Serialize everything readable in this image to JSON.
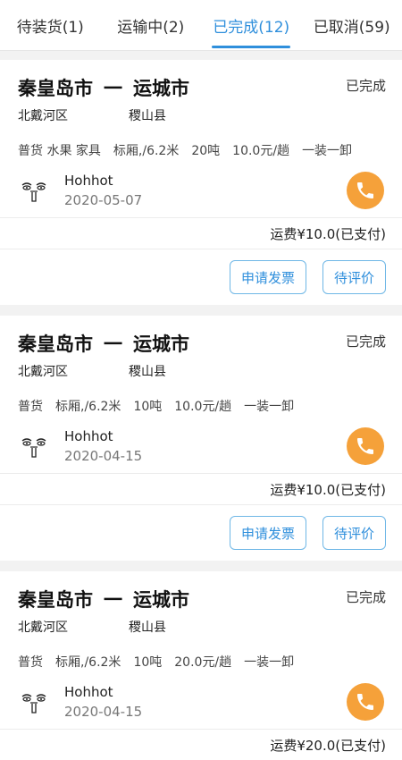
{
  "tabs": [
    {
      "label": "待装货(1)",
      "active": false
    },
    {
      "label": "运输中(2)",
      "active": false
    },
    {
      "label": "已完成(12)",
      "active": true
    },
    {
      "label": "已取消(59)",
      "active": false
    }
  ],
  "orders": [
    {
      "from_city": "秦皇岛市",
      "dash": "一",
      "to_city": "运城市",
      "from_district": "北戴河区",
      "to_district": "稷山县",
      "status": "已完成",
      "goods": [
        "普货 水果 家具",
        "标厢,/6.2米",
        "20吨",
        "10.0元/趟",
        "一装一卸"
      ],
      "contact_name": "Hohhot",
      "date": "2020-05-07",
      "fee": "运费¥10.0(已支付)",
      "buttons": [
        "申请发票",
        "待评价"
      ]
    },
    {
      "from_city": "秦皇岛市",
      "dash": "一",
      "to_city": "运城市",
      "from_district": "北戴河区",
      "to_district": "稷山县",
      "status": "已完成",
      "goods": [
        "普货",
        "标厢,/6.2米",
        "10吨",
        "10.0元/趟",
        "一装一卸"
      ],
      "contact_name": "Hohhot",
      "date": "2020-04-15",
      "fee": "运费¥10.0(已支付)",
      "buttons": [
        "申请发票",
        "待评价"
      ]
    },
    {
      "from_city": "秦皇岛市",
      "dash": "一",
      "to_city": "运城市",
      "from_district": "北戴河区",
      "to_district": "稷山县",
      "status": "已完成",
      "goods": [
        "普货",
        "标厢,/6.2米",
        "10吨",
        "20.0元/趟",
        "一装一卸"
      ],
      "contact_name": "Hohhot",
      "date": "2020-04-15",
      "fee": "运费¥20.0(已支付)",
      "buttons": []
    }
  ],
  "icons": {
    "phone": "phone-icon",
    "avatar": "avatar-icon"
  },
  "colors": {
    "accent": "#2f8fdc",
    "phone": "#f5a13a"
  }
}
